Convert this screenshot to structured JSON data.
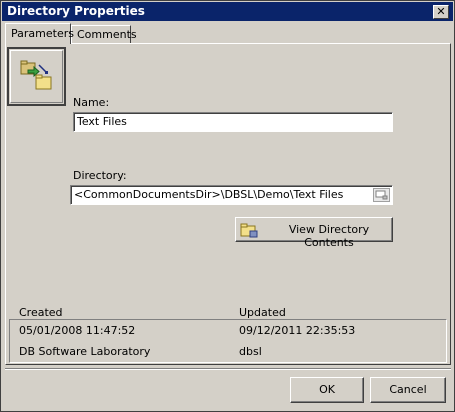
{
  "window": {
    "title": "Directory Properties",
    "close_glyph": "✕"
  },
  "tabs": [
    {
      "label": "Parameters",
      "active": true
    },
    {
      "label": "Comments",
      "active": false
    }
  ],
  "form": {
    "icon": "directory-properties-icon",
    "name_label": "Name:",
    "name_value": "Text Files",
    "directory_label": "Directory:",
    "directory_value": "<CommonDocumentsDir>\\DBSL\\Demo\\Text Files",
    "view_button_label": "View Directory Contents"
  },
  "info": {
    "created_label": "Created",
    "updated_label": "Updated",
    "created_date": "05/01/2008 11:47:52",
    "updated_date": "09/12/2011 22:35:53",
    "created_by": "DB Software Laboratory",
    "updated_by": "dbsl"
  },
  "footer": {
    "ok_label": "OK",
    "cancel_label": "Cancel"
  },
  "colors": {
    "titlebar": "#0a246a",
    "face": "#d4d0c8"
  }
}
